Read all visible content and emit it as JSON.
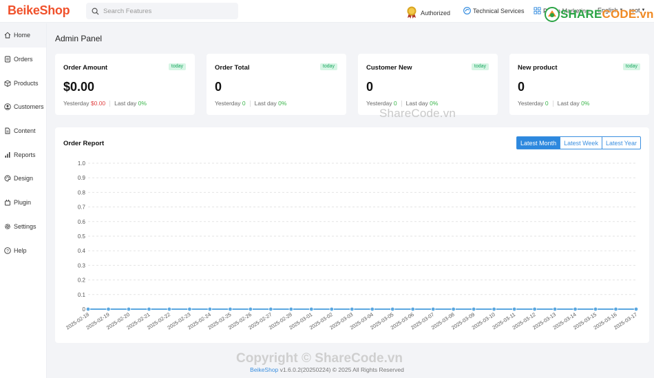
{
  "header": {
    "logo": "BeikeShop",
    "search_placeholder": "Search Features",
    "authorized": "Authorized",
    "technical_services": "Technical Services",
    "plugin_marketing": "Plugin Marketing",
    "language": "English",
    "user": "root"
  },
  "watermarks": {
    "top_share": "SHARE",
    "top_code": "CODE.vn",
    "mid": "ShareCode.vn",
    "bottom": "Copyright © ShareCode.vn"
  },
  "sidebar": {
    "items": [
      {
        "label": "Home",
        "icon": "home-icon"
      },
      {
        "label": "Orders",
        "icon": "orders-icon"
      },
      {
        "label": "Products",
        "icon": "box-icon"
      },
      {
        "label": "Customers",
        "icon": "user-icon"
      },
      {
        "label": "Content",
        "icon": "file-icon"
      },
      {
        "label": "Reports",
        "icon": "bar-chart-icon"
      },
      {
        "label": "Design",
        "icon": "palette-icon"
      },
      {
        "label": "Plugin",
        "icon": "plugin-icon"
      },
      {
        "label": "Settings",
        "icon": "gear-icon"
      },
      {
        "label": "Help",
        "icon": "help-icon"
      }
    ]
  },
  "page_title": "Admin Panel",
  "cards": [
    {
      "title": "Order Amount",
      "badge": "today",
      "value": "$0.00",
      "yesterday_label": "Yesterday",
      "yesterday_value": "$0.00",
      "lastday_label": "Last day",
      "lastday_value": "0%"
    },
    {
      "title": "Order Total",
      "badge": "today",
      "value": "0",
      "yesterday_label": "Yesterday",
      "yesterday_value": "0",
      "lastday_label": "Last day",
      "lastday_value": "0%"
    },
    {
      "title": "Customer New",
      "badge": "today",
      "value": "0",
      "yesterday_label": "Yesterday",
      "yesterday_value": "0",
      "lastday_label": "Last day",
      "lastday_value": "0%"
    },
    {
      "title": "New product",
      "badge": "today",
      "value": "0",
      "yesterday_label": "Yesterday",
      "yesterday_value": "0",
      "lastday_label": "Last day",
      "lastday_value": "0%"
    }
  ],
  "report": {
    "title": "Order Report",
    "buttons": [
      "Latest Month",
      "Latest Week",
      "Latest Year"
    ],
    "active_button": "Latest Month"
  },
  "chart_data": {
    "type": "line",
    "x": [
      "2025-02-18",
      "2025-02-19",
      "2025-02-20",
      "2025-02-21",
      "2025-02-22",
      "2025-02-23",
      "2025-02-24",
      "2025-02-25",
      "2025-02-26",
      "2025-02-27",
      "2025-02-28",
      "2025-03-01",
      "2025-03-02",
      "2025-03-03",
      "2025-03-04",
      "2025-03-05",
      "2025-03-06",
      "2025-03-07",
      "2025-03-08",
      "2025-03-09",
      "2025-03-10",
      "2025-03-11",
      "2025-03-12",
      "2025-03-13",
      "2025-03-14",
      "2025-03-15",
      "2025-03-16",
      "2025-03-17"
    ],
    "series": [
      {
        "values": [
          0,
          0,
          0,
          0,
          0,
          0,
          0,
          0,
          0,
          0,
          0,
          0,
          0,
          0,
          0,
          0,
          0,
          0,
          0,
          0,
          0,
          0,
          0,
          0,
          0,
          0,
          0,
          0
        ],
        "color": "#5aa7e0"
      }
    ],
    "yticks": [
      "0",
      "0.1",
      "0.2",
      "0.3",
      "0.4",
      "0.5",
      "0.6",
      "0.7",
      "0.8",
      "0.9",
      "1.0"
    ],
    "ylim": [
      0,
      1
    ],
    "grid": true
  },
  "footer": {
    "brand": "BeikeShop",
    "text": "v1.6.0.2(20250224) © 2025 All Rights Reserved"
  },
  "colors": {
    "logo": "#f0512b",
    "accent": "#2d88de",
    "badge_bg": "#d7f5e5",
    "badge_text": "#1aa860",
    "negative": "#e04040",
    "positive": "#39b54a"
  }
}
